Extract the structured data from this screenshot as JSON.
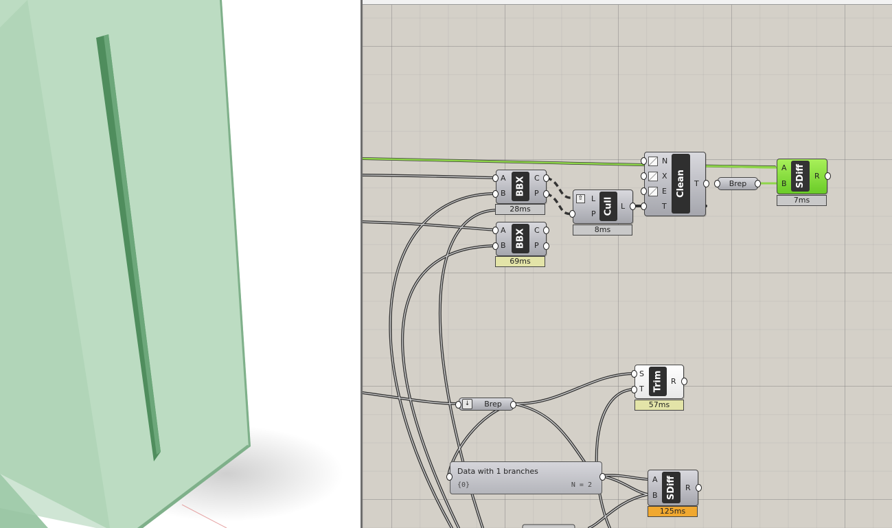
{
  "canvas": {
    "components": {
      "bbx1": {
        "nickname": "BBX",
        "inputs": [
          "A",
          "B"
        ],
        "outputs": [
          "C",
          "P"
        ],
        "time": "28ms"
      },
      "bbx2": {
        "nickname": "BBX",
        "inputs": [
          "A",
          "B"
        ],
        "outputs": [
          "C",
          "P"
        ],
        "time": "69ms"
      },
      "cull": {
        "nickname": "Cull",
        "inputs": [
          "L",
          "P"
        ],
        "outputs": [
          "L"
        ],
        "time": "8ms"
      },
      "clean": {
        "nickname": "Clean",
        "inputs": [
          "N",
          "X",
          "E",
          "T"
        ],
        "outputs": [
          "T"
        ]
      },
      "sdiff1": {
        "nickname": "SDiff",
        "inputs": [
          "A",
          "B"
        ],
        "outputs": [
          "R"
        ],
        "time": "7ms"
      },
      "trim": {
        "nickname": "Trim",
        "inputs": [
          "S",
          "T"
        ],
        "outputs": [
          "R"
        ],
        "time": "57ms"
      },
      "sdiff2": {
        "nickname": "SDiff",
        "inputs": [
          "A",
          "B"
        ],
        "outputs": [
          "R"
        ],
        "time": "125ms"
      }
    },
    "params": {
      "brep1": {
        "label": "Brep"
      },
      "brep2": {
        "label": "Brep"
      }
    },
    "panel": {
      "title": "Data with 1 branches",
      "path": "{0}",
      "count": "N = 2"
    },
    "colors": {
      "canvas": "#d4d0c8",
      "selected_green": "#7ed63a",
      "warning_orange": "#f0a830",
      "geometry_green": "#b9dcbf"
    }
  }
}
